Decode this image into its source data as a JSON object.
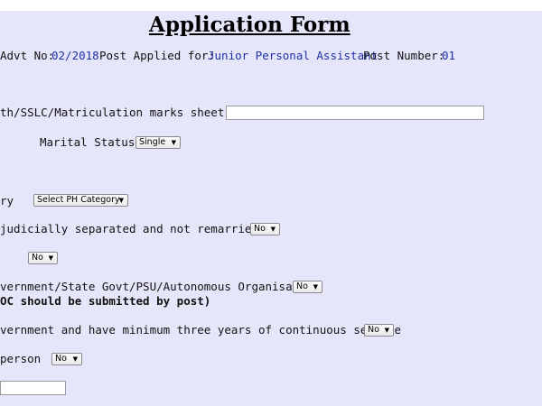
{
  "title": "Application Form",
  "header": {
    "advt_label": "Advt No:",
    "advt_value": "02/2018",
    "post_label": "Post Applied for:",
    "post_value": "Junior Personal Assistant",
    "post_number_label": "Post Number:",
    "post_number_value": "01"
  },
  "fields": {
    "dob_label": "th/SSLC/Matriculation marks sheet)",
    "dob_input_value": "",
    "marital_label": "Marital Status",
    "marital_value": "Single",
    "ph_label": "ry",
    "ph_value": "Select PH Category",
    "separated_label": "judicially separated and not remarried",
    "separated_value": "No",
    "misc_value": "No",
    "govt_label": "vernment/State Govt/PSU/Autonomous Organisation",
    "govt_value": "No",
    "noc_note": "OC should be submitted by post)",
    "service_label": "vernment and have minimum three years of continuous service",
    "service_value": "No",
    "person_label": "person",
    "person_value": "No",
    "last_input_value": ""
  },
  "icons": {
    "dropdown_arrow": "chevron-down-icon"
  }
}
